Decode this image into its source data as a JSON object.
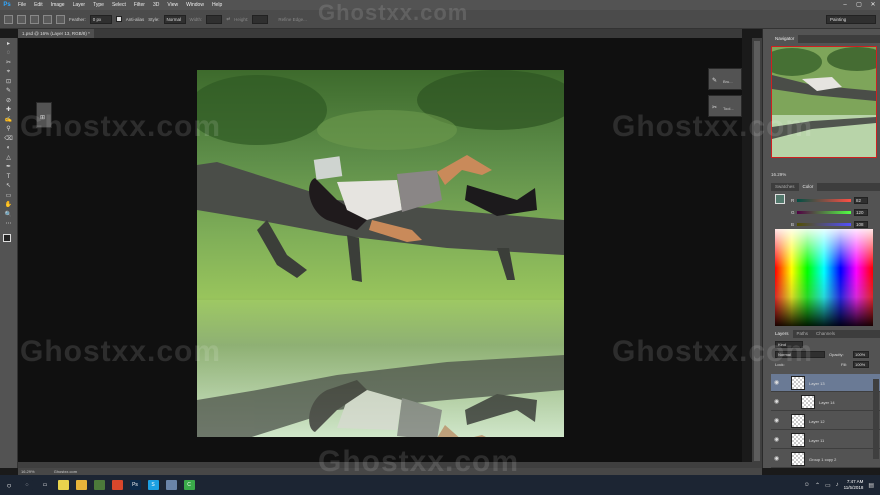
{
  "app": {
    "logo": "Ps"
  },
  "menubar": {
    "items": [
      "File",
      "Edit",
      "Image",
      "Layer",
      "Type",
      "Select",
      "Filter",
      "3D",
      "View",
      "Window",
      "Help"
    ],
    "minimize": "–",
    "maximize": "▢",
    "close": "✕"
  },
  "options": {
    "feather_label": "Feather:",
    "feather_value": "0 px",
    "antialias_label": "Anti-alias",
    "style_label": "Style:",
    "style_value": "Normal",
    "width_label": "Width:",
    "height_label": "Height:",
    "refine_edge": "Refine Edge...",
    "workspace": "Painting"
  },
  "document": {
    "tab_title": "1.psd @ 16% (Layer 13, RGB/8) *",
    "zoom": "16.29%",
    "doc_info": "Ghostxx.com"
  },
  "tools": [
    "▸",
    "◌",
    "✂",
    "⌖",
    "⊡",
    "✎",
    "⊘",
    "✚",
    "✍",
    "⚲",
    "⌫",
    "◐",
    "△",
    "✒",
    "T",
    "↖",
    "▭",
    "✋",
    "🔍",
    "⋯"
  ],
  "float_panels": {
    "brush_label": "Bru...",
    "tool_label": "Tool..."
  },
  "right_dock": {
    "navigator_tab": "Navigator",
    "nav_zoom": "16.29%",
    "swatches_tab": "Swatches",
    "color_tab": "Color",
    "color_sliders": [
      {
        "label": "R",
        "value": "82",
        "gradient": "linear-gradient(to right,#004f44,#ff4f44)"
      },
      {
        "label": "G",
        "value": "120",
        "gradient": "linear-gradient(to right,#520044,#52ff44)"
      },
      {
        "label": "B",
        "value": "108",
        "gradient": "linear-gradient(to right,#524f00,#524fff)"
      }
    ],
    "layers_tab": "Layers",
    "paths_tab": "Paths",
    "channels_tab": "Channels",
    "kind_label": "Kind",
    "blend_mode": "Normal",
    "opacity_label": "Opacity:",
    "opacity_value": "100%",
    "lock_label": "Lock:",
    "fill_label": "Fill:",
    "fill_value": "100%",
    "layers": [
      {
        "name": "Layer 13",
        "selected": true,
        "indent": false
      },
      {
        "name": "Layer 14",
        "selected": false,
        "indent": true
      },
      {
        "name": "Layer 12",
        "selected": false,
        "indent": false
      },
      {
        "name": "Layer 11",
        "selected": false,
        "indent": false
      },
      {
        "name": "Group 1 copy 2",
        "selected": false,
        "indent": false
      }
    ]
  },
  "taskbar": {
    "start": "○",
    "apps": [
      {
        "name": "search",
        "color": "#1c2533",
        "glyph": "◌"
      },
      {
        "name": "task-view",
        "color": "#1c2533",
        "glyph": "▭"
      },
      {
        "name": "sticky",
        "color": "#e8d44d",
        "glyph": ""
      },
      {
        "name": "explorer",
        "color": "#e6b33a",
        "glyph": ""
      },
      {
        "name": "app1",
        "color": "#4c7a3a",
        "glyph": ""
      },
      {
        "name": "chrome",
        "color": "#d9472b",
        "glyph": ""
      },
      {
        "name": "photoshop",
        "color": "#0b2a4a",
        "glyph": "Ps"
      },
      {
        "name": "skype",
        "color": "#1ca0e3",
        "glyph": "S"
      },
      {
        "name": "mail",
        "color": "#6a84a8",
        "glyph": ""
      },
      {
        "name": "app2",
        "color": "#3aaa4a",
        "glyph": "C"
      }
    ],
    "time": "7:47 AM",
    "date": "11/5/2018"
  },
  "watermark": "Ghostxx.com"
}
